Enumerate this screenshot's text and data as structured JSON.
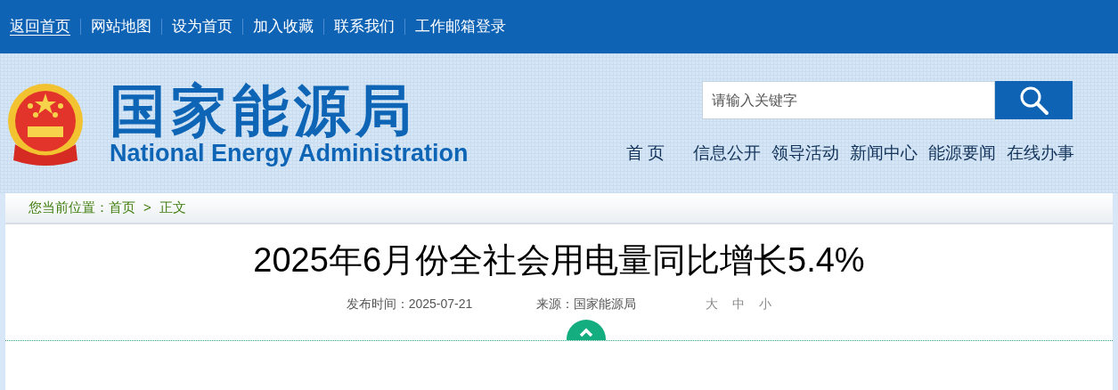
{
  "top_links": [
    {
      "label": "返回首页",
      "selected": true
    },
    {
      "label": "网站地图",
      "selected": false
    },
    {
      "label": "设为首页",
      "selected": false
    },
    {
      "label": "加入收藏",
      "selected": false
    },
    {
      "label": "联系我们",
      "selected": false
    },
    {
      "label": "工作邮箱登录",
      "selected": false
    }
  ],
  "logo": {
    "name_cn": "国家能源局",
    "name_en": "National Energy Administration"
  },
  "search": {
    "placeholder": "请输入关键字"
  },
  "nav": [
    "首 页",
    "信息公开",
    "领导活动",
    "新闻中心",
    "能源要闻",
    "在线办事"
  ],
  "breadcrumb": {
    "prefix": "您当前位置：",
    "items": [
      "首页",
      "正文"
    ],
    "separator": ">"
  },
  "article": {
    "title": "2025年6月份全社会用电量同比增长5.4%",
    "published": "发布时间：2025-07-21",
    "source": "来源：国家能源局",
    "font_sizes": [
      "大",
      "中",
      "小"
    ]
  }
}
